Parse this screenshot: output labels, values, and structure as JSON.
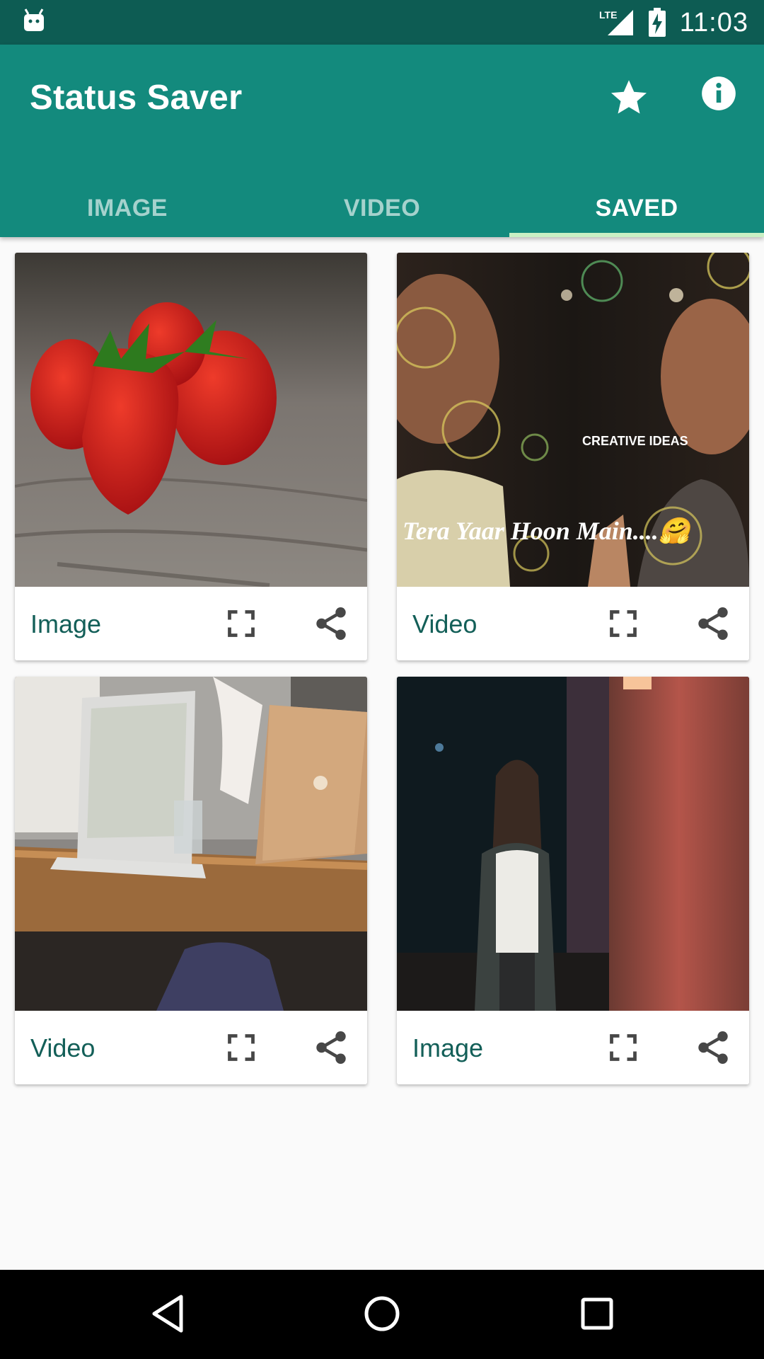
{
  "status_bar": {
    "network": "LTE",
    "time": "11:03"
  },
  "app": {
    "title": "Status Saver"
  },
  "tabs": [
    {
      "label": "IMAGE",
      "active": false
    },
    {
      "label": "VIDEO",
      "active": false
    },
    {
      "label": "SAVED",
      "active": true
    }
  ],
  "cards": [
    {
      "label": "Image",
      "thumbnail": "strawberries"
    },
    {
      "label": "Video",
      "thumbnail": "two-men-bubbles",
      "overlay_small": "CREATIVE IDEAS",
      "overlay_caption": "Tera Yaar Hoon Main....🤗"
    },
    {
      "label": "Video",
      "thumbnail": "laptops-on-table"
    },
    {
      "label": "Image",
      "thumbnail": "girl-at-night"
    }
  ],
  "icons": {
    "app_bar": [
      "star-icon",
      "info-icon"
    ],
    "card_actions": [
      "fullscreen-icon",
      "share-icon"
    ],
    "nav": [
      "back-icon",
      "home-icon",
      "recents-icon"
    ]
  },
  "colors": {
    "status_bar": "#0d5c53",
    "primary": "#138a7d",
    "tab_indicator": "#c9f0c4",
    "card_label": "#135f58"
  }
}
